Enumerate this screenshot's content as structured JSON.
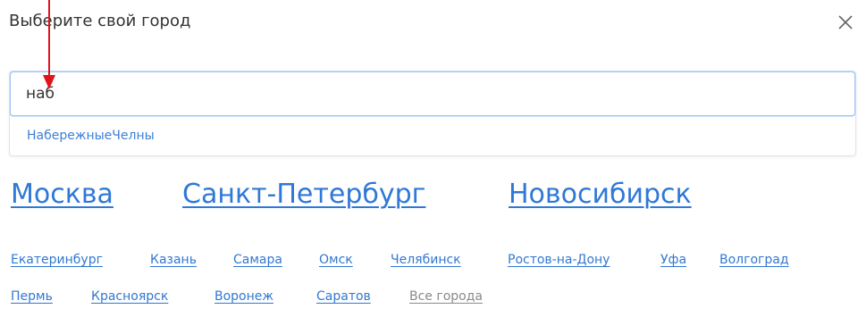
{
  "dialog": {
    "title": "Выберите свой город",
    "close_icon": "close-icon"
  },
  "search": {
    "value": "наб",
    "placeholder": "",
    "suggestions": [
      "НабережныеЧелны"
    ]
  },
  "major_cities": [
    "Москва",
    "Санкт-Петербург",
    "Новосибирск"
  ],
  "other_cities_row1": [
    "Екатеринбург",
    "Казань",
    "Самара",
    "Омск",
    "Челябинск",
    "Ростов-на-Дону",
    "Уфа",
    "Волгоград"
  ],
  "other_cities_row2": [
    "Пермь",
    "Красноярск",
    "Воронеж",
    "Саратов"
  ],
  "all_cities_link": "Все города",
  "colors": {
    "link": "#2f78d6",
    "annotation_arrow": "#e0151b",
    "focus_border": "#9ec4f3"
  }
}
